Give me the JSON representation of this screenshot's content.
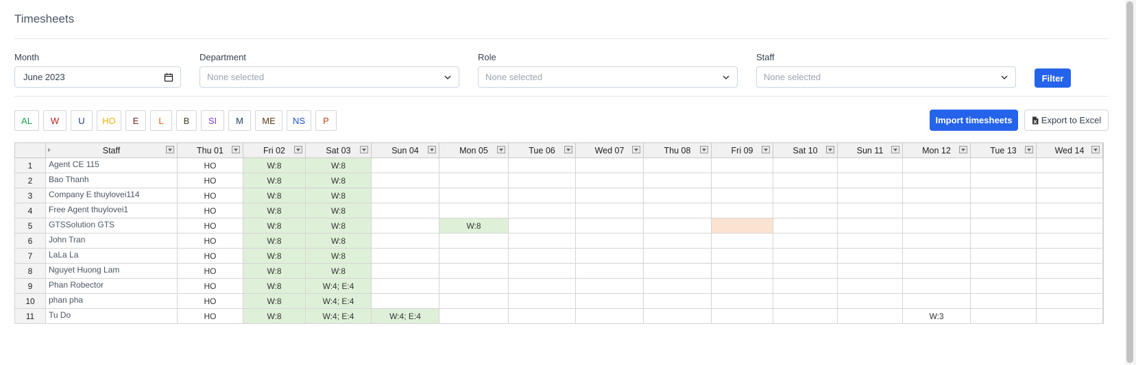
{
  "page": {
    "title": "Timesheets"
  },
  "filters": {
    "month": {
      "label": "Month",
      "value": "June  2023"
    },
    "department": {
      "label": "Department",
      "placeholder": "None selected"
    },
    "role": {
      "label": "Role",
      "placeholder": "None selected"
    },
    "staff": {
      "label": "Staff",
      "placeholder": "None selected"
    },
    "filter_button": "Filter"
  },
  "legend": [
    {
      "code": "AL",
      "color": "#16a34a"
    },
    {
      "code": "W",
      "color": "#b91c1c"
    },
    {
      "code": "U",
      "color": "#1e3a8a"
    },
    {
      "code": "HO",
      "color": "#eab308"
    },
    {
      "code": "E",
      "color": "#7f1d1d"
    },
    {
      "code": "L",
      "color": "#ea580c"
    },
    {
      "code": "B",
      "color": "#3f3f1f"
    },
    {
      "code": "SI",
      "color": "#7c3aed"
    },
    {
      "code": "M",
      "color": "#1e3a5f"
    },
    {
      "code": "ME",
      "color": "#5b3a1a"
    },
    {
      "code": "NS",
      "color": "#1d4ed8"
    },
    {
      "code": "P",
      "color": "#c2410c"
    }
  ],
  "actions": {
    "import": "Import timesheets",
    "export": "Export to Excel"
  },
  "table": {
    "columns": [
      "Staff",
      "Thu 01",
      "Fri 02",
      "Sat 03",
      "Sun 04",
      "Mon 05",
      "Tue 06",
      "Wed 07",
      "Thu 08",
      "Fri 09",
      "Sat 10",
      "Sun 11",
      "Mon 12",
      "Tue 13",
      "Wed 14"
    ],
    "rows": [
      {
        "num": "1",
        "staff": "Agent CE 115",
        "cells": [
          "HO",
          "W:8",
          "W:8",
          "",
          "",
          "",
          "",
          "",
          "",
          "",
          "",
          "",
          "",
          ""
        ]
      },
      {
        "num": "2",
        "staff": "Bao Thanh",
        "cells": [
          "HO",
          "W:8",
          "W:8",
          "",
          "",
          "",
          "",
          "",
          "",
          "",
          "",
          "",
          "",
          ""
        ]
      },
      {
        "num": "3",
        "staff": "Company E thuylovei114",
        "cells": [
          "HO",
          "W:8",
          "W:8",
          "",
          "",
          "",
          "",
          "",
          "",
          "",
          "",
          "",
          "",
          ""
        ]
      },
      {
        "num": "4",
        "staff": "Free Agent thuylovei1",
        "cells": [
          "HO",
          "W:8",
          "W:8",
          "",
          "",
          "",
          "",
          "",
          "",
          "",
          "",
          "",
          "",
          ""
        ]
      },
      {
        "num": "5",
        "staff": "GTSSolution GTS",
        "cells": [
          "HO",
          "W:8",
          "W:8",
          "",
          "W:8",
          "",
          "",
          "",
          "",
          "",
          "",
          "",
          "",
          ""
        ]
      },
      {
        "num": "6",
        "staff": "John Tran",
        "cells": [
          "HO",
          "W:8",
          "W:8",
          "",
          "",
          "",
          "",
          "",
          "",
          "",
          "",
          "",
          "",
          ""
        ]
      },
      {
        "num": "7",
        "staff": "LaLa La",
        "cells": [
          "HO",
          "W:8",
          "W:8",
          "",
          "",
          "",
          "",
          "",
          "",
          "",
          "",
          "",
          "",
          ""
        ]
      },
      {
        "num": "8",
        "staff": "Nguyet Huong Lam",
        "cells": [
          "HO",
          "W:8",
          "W:8",
          "",
          "",
          "",
          "",
          "",
          "",
          "",
          "",
          "",
          "",
          ""
        ]
      },
      {
        "num": "9",
        "staff": "Phan Robector",
        "cells": [
          "HO",
          "W:8",
          "W:4; E:4",
          "",
          "",
          "",
          "",
          "",
          "",
          "",
          "",
          "",
          "",
          ""
        ]
      },
      {
        "num": "10",
        "staff": "phan pha",
        "cells": [
          "HO",
          "W:8",
          "W:4; E:4",
          "",
          "",
          "",
          "",
          "",
          "",
          "",
          "",
          "",
          "",
          ""
        ]
      },
      {
        "num": "11",
        "staff": "Tu Do",
        "cells": [
          "HO",
          "W:8",
          "W:4; E:4",
          "W:4; E:4",
          "",
          "",
          "",
          "",
          "",
          "",
          "",
          "W:3",
          "",
          ""
        ]
      }
    ]
  }
}
